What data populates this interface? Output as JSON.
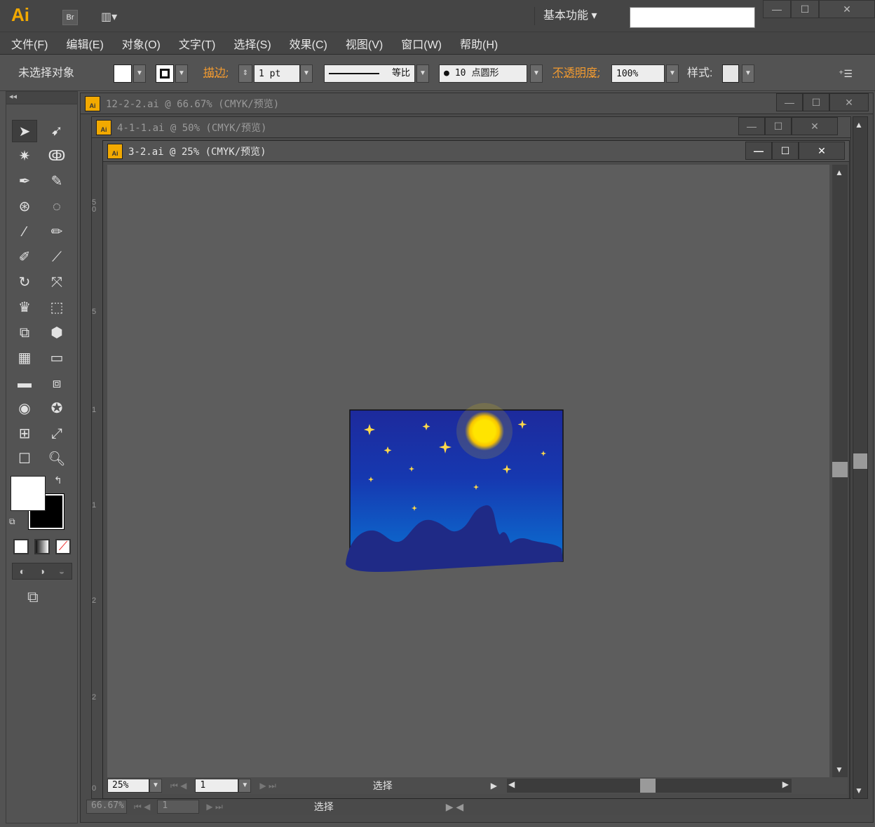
{
  "app": {
    "logo": "Ai",
    "bridge": "Br",
    "workspace": "基本功能"
  },
  "menu": [
    "文件(F)",
    "编辑(E)",
    "对象(O)",
    "文字(T)",
    "选择(S)",
    "效果(C)",
    "视图(V)",
    "窗口(W)",
    "帮助(H)"
  ],
  "control": {
    "selection": "未选择对象",
    "stroke_label": "描边:",
    "stroke_value": "1 pt",
    "profile": "等比",
    "brush_size": "10",
    "brush_type": "点圆形",
    "opacity_label": "不透明度:",
    "opacity_value": "100%",
    "style_label": "样式:"
  },
  "docs": [
    {
      "title": "12-2-2.ai @ 66.67% (CMYK/预览)",
      "zoom": "66.67%",
      "page": "1",
      "status": "选择"
    },
    {
      "title": "4-1-1.ai @ 50% (CMYK/预览)"
    },
    {
      "title": "3-2.ai @ 25% (CMYK/预览)",
      "zoom": "25%",
      "page": "1",
      "status": "选择"
    }
  ],
  "rulers": [
    "5",
    "0",
    "5",
    "1",
    "1",
    "2",
    "2",
    "0",
    "0",
    "0",
    "5",
    "0",
    "0",
    "0",
    "0",
    "5",
    "0"
  ],
  "colors": {
    "sky_top": "#1d2a9c",
    "sky_bottom": "#0b6fd1",
    "mountain": "#1f2a86",
    "moon": "#ffe400"
  }
}
